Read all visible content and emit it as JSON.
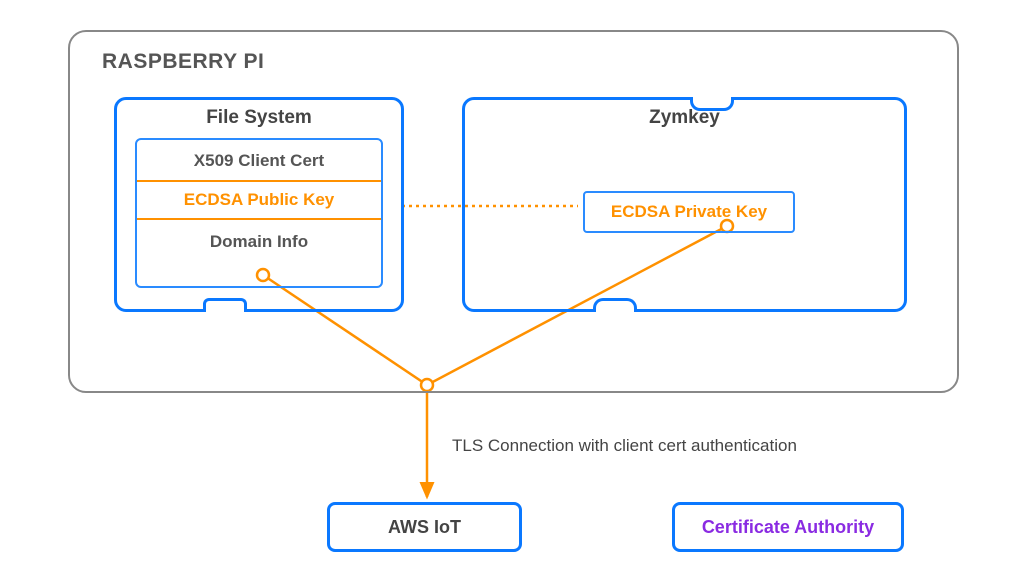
{
  "raspberry": {
    "title": "RASPBERRY PI",
    "filesystem": {
      "title": "File System",
      "cert_label": "X509 Client Cert",
      "pubkey_label": "ECDSA Public Key",
      "domain_label": "Domain Info"
    },
    "zymkey": {
      "title": "Zymkey",
      "privkey_label": "ECDSA Private Key"
    }
  },
  "connection_label": "TLS Connection with client cert authentication",
  "aws_label": "AWS IoT",
  "ca_label": "Certificate Authority",
  "colors": {
    "blue": "#0a78ff",
    "orange": "#ff9100",
    "purple": "#8a2be2",
    "grey": "#888"
  }
}
